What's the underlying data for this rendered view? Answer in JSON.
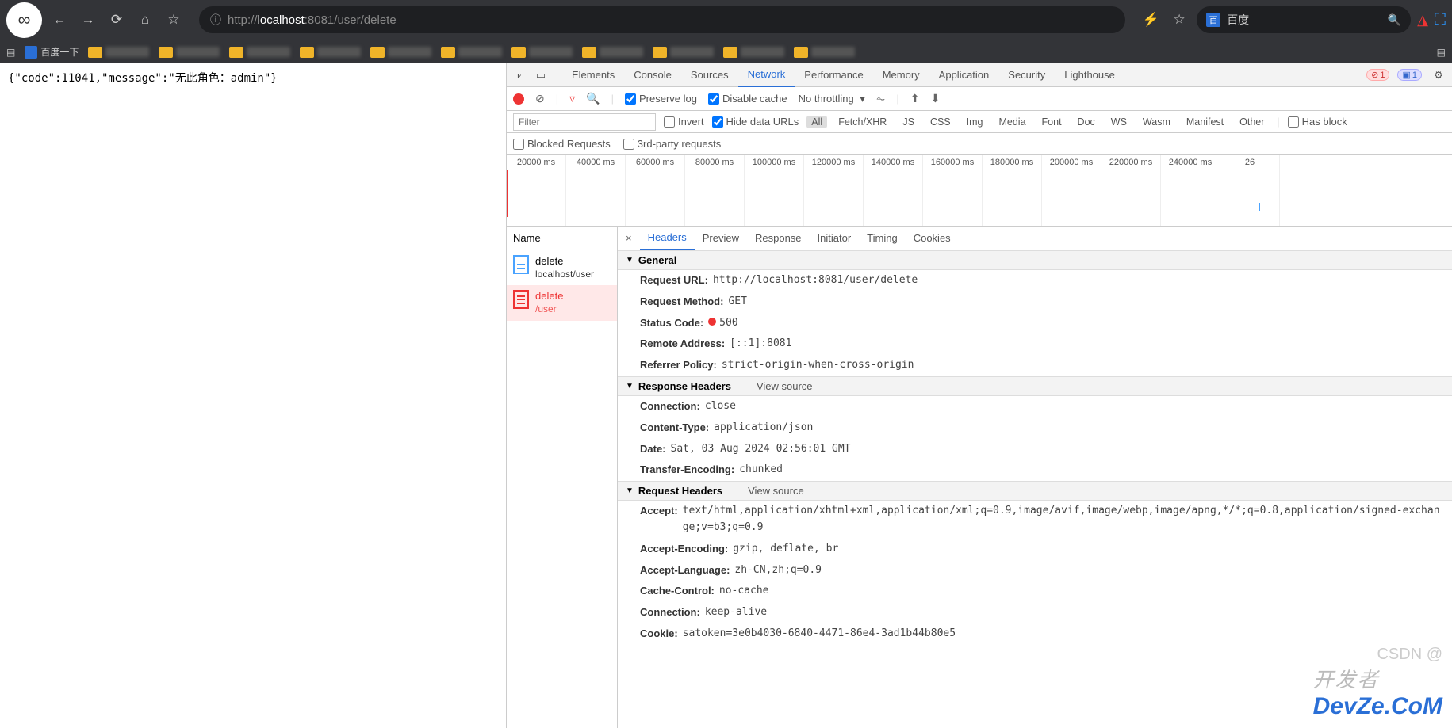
{
  "browser": {
    "url_display_prefix": "http://",
    "url_display_host": "localhost",
    "url_display_port": ":8081",
    "url_display_path": "/user/delete",
    "search_placeholder": "百度",
    "bookmark_label": "百度一下"
  },
  "page": {
    "body_text": "{\"code\":11041,\"message\":\"无此角色：admin\"}"
  },
  "devtools": {
    "tabs": [
      "Elements",
      "Console",
      "Sources",
      "Network",
      "Performance",
      "Memory",
      "Application",
      "Security",
      "Lighthouse"
    ],
    "active_tab": "Network",
    "error_count": "1",
    "info_count": "1",
    "toolbar": {
      "preserve_log": "Preserve log",
      "disable_cache": "Disable cache",
      "throttling": "No throttling"
    },
    "filters": {
      "filter_placeholder": "Filter",
      "invert": "Invert",
      "hide_data_urls": "Hide data URLs",
      "types": [
        "All",
        "Fetch/XHR",
        "JS",
        "CSS",
        "Img",
        "Media",
        "Font",
        "Doc",
        "WS",
        "Wasm",
        "Manifest",
        "Other"
      ],
      "active_type": "All",
      "has_blocked": "Has block",
      "blocked_requests": "Blocked Requests",
      "third_party": "3rd-party requests"
    },
    "timeline_ticks": [
      "20000 ms",
      "40000 ms",
      "60000 ms",
      "80000 ms",
      "100000 ms",
      "120000 ms",
      "140000 ms",
      "160000 ms",
      "180000 ms",
      "200000 ms",
      "220000 ms",
      "240000 ms",
      "26"
    ],
    "name_col": "Name",
    "requests": [
      {
        "name": "delete",
        "sub": "localhost/user",
        "error": false
      },
      {
        "name": "delete",
        "sub": "/user",
        "error": true
      }
    ],
    "detail_tabs": [
      "Headers",
      "Preview",
      "Response",
      "Initiator",
      "Timing",
      "Cookies"
    ],
    "active_detail": "Headers",
    "sections": {
      "general": {
        "title": "General",
        "items": [
          {
            "k": "Request URL:",
            "v": "http://localhost:8081/user/delete"
          },
          {
            "k": "Request Method:",
            "v": "GET"
          },
          {
            "k": "Status Code:",
            "v": "500",
            "status": true
          },
          {
            "k": "Remote Address:",
            "v": "[::1]:8081"
          },
          {
            "k": "Referrer Policy:",
            "v": "strict-origin-when-cross-origin"
          }
        ]
      },
      "response_headers": {
        "title": "Response Headers",
        "view_source": "View source",
        "items": [
          {
            "k": "Connection:",
            "v": "close"
          },
          {
            "k": "Content-Type:",
            "v": "application/json"
          },
          {
            "k": "Date:",
            "v": "Sat, 03 Aug 2024 02:56:01 GMT"
          },
          {
            "k": "Transfer-Encoding:",
            "v": "chunked"
          }
        ]
      },
      "request_headers": {
        "title": "Request Headers",
        "view_source": "View source",
        "items": [
          {
            "k": "Accept:",
            "v": "text/html,application/xhtml+xml,application/xml;q=0.9,image/avif,image/webp,image/apng,*/*;q=0.8,application/signed-exchange;v=b3;q=0.9"
          },
          {
            "k": "Accept-Encoding:",
            "v": "gzip, deflate, br"
          },
          {
            "k": "Accept-Language:",
            "v": "zh-CN,zh;q=0.9"
          },
          {
            "k": "Cache-Control:",
            "v": "no-cache"
          },
          {
            "k": "Connection:",
            "v": "keep-alive"
          },
          {
            "k": "Cookie:",
            "v": "satoken=3e0b4030-6840-4471-86e4-3ad1b44b80e5"
          }
        ]
      }
    }
  },
  "watermark": {
    "line1": "开发者",
    "line2": "DevZe.CoM",
    "csdn": "CSDN @"
  }
}
